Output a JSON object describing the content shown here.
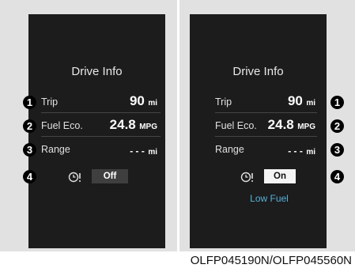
{
  "left": {
    "title": "Drive Info",
    "trip": {
      "label": "Trip",
      "value": "90",
      "unit": "mi"
    },
    "fuel": {
      "label": "Fuel Eco.",
      "value": "24.8",
      "unit": "MPG"
    },
    "range": {
      "label": "Range",
      "value": "- - -",
      "unit": "mi"
    },
    "toggle": {
      "value": "Off"
    },
    "markers": [
      "1",
      "2",
      "3",
      "4"
    ]
  },
  "right": {
    "title": "Drive Info",
    "trip": {
      "label": "Trip",
      "value": "90",
      "unit": "mi"
    },
    "fuel": {
      "label": "Fuel Eco.",
      "value": "24.8",
      "unit": "MPG"
    },
    "range": {
      "label": "Range",
      "value": "- - -",
      "unit": "mi"
    },
    "toggle": {
      "value": "On"
    },
    "warning": "Low Fuel",
    "markers": [
      "1",
      "2",
      "3",
      "4"
    ]
  },
  "caption": "OLFP045190N/OLFP045560N",
  "icons": {
    "timer": "clock-with-alert-icon"
  },
  "colors": {
    "screen": "#1c1c1c",
    "accent": "#56b0d8",
    "frame": "#e1e1e1"
  }
}
